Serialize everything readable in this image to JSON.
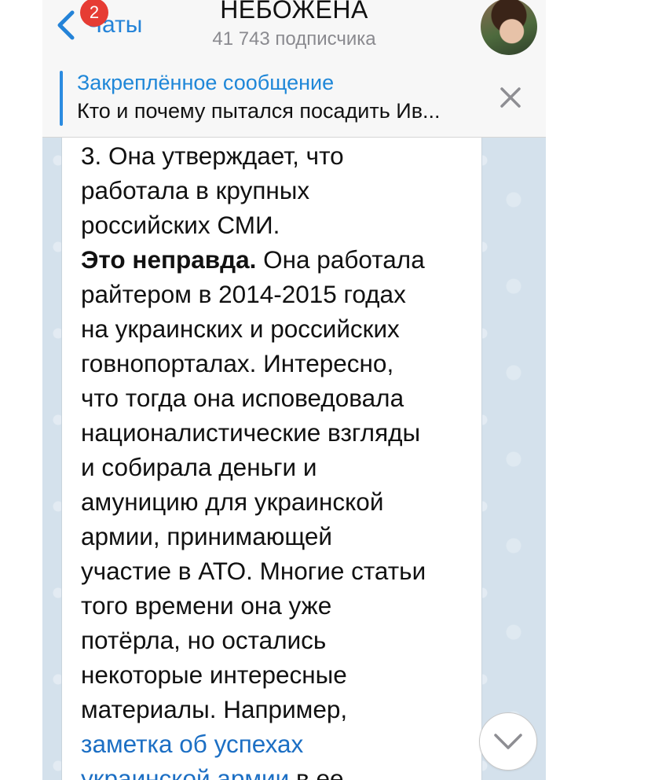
{
  "header": {
    "back_label": "Чаты",
    "unread_badge": "2",
    "title": "НЕБОЖЕНА",
    "subtitle": "41 743 подписчика"
  },
  "pinned": {
    "title": "Закреплённое сообщение",
    "text": "Кто и почему пытался посадить Ив..."
  },
  "message": {
    "line1": "3. Она утверждает, что",
    "line2": "работала в крупных",
    "line3": "российских СМИ.",
    "bold": "Это неправда.",
    "line4_rest": " Она работала",
    "line5": "райтером в 2014-2015 годах",
    "line6": "на украинских и российских",
    "line7": "говнопорталах. Интересно,",
    "line8": "что тогда она исповедовала",
    "line9": "националистические взгляды",
    "line10": "и собирала деньги и",
    "line11": "амуницию для украинской",
    "line12": "армии, принимающей",
    "line13": "участие в АТО. Многие статьи",
    "line14": "того времени она уже",
    "line15": "потёрла, но остались",
    "line16": "некоторые интересные",
    "line17": "материалы. Например,",
    "link_line1": "заметка об успехах",
    "link_line2": "украинской армии",
    "line18_rest": " в ее"
  },
  "icons": {
    "back": "chevron-left-icon",
    "close": "close-icon",
    "scroll": "chevron-down-icon"
  },
  "colors": {
    "accent": "#2483d8",
    "badge": "#e63c34",
    "wallpaper": "#d4e1ec"
  }
}
